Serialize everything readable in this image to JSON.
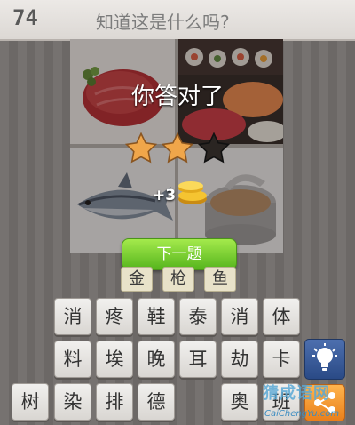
{
  "header": {
    "level": "74",
    "title": "知道这是什么吗?"
  },
  "result": {
    "message": "你答对了",
    "stars_earned": 2,
    "stars_total": 3,
    "bonus": "+3"
  },
  "next_button": "下一题",
  "answer": [
    "金",
    "枪",
    "鱼"
  ],
  "keyboard": {
    "row1": [
      "消",
      "疼",
      "鞋",
      "泰",
      "消",
      "体"
    ],
    "row2": [
      "料",
      "埃",
      "晚",
      "耳",
      "劫",
      "卡"
    ],
    "row3_left": [
      "树",
      "染",
      "排",
      "德"
    ],
    "row3_right": [
      "奥",
      "班"
    ]
  },
  "watermark": {
    "top": "猜成语网",
    "bottom": "CaiChengYu.com"
  },
  "icons": {
    "hint": "lightbulb-icon",
    "share": "share-icon"
  },
  "colors": {
    "next_button": "#6cc92c",
    "hint_button": "#3a5c9c",
    "share_button": "#f39a32"
  }
}
